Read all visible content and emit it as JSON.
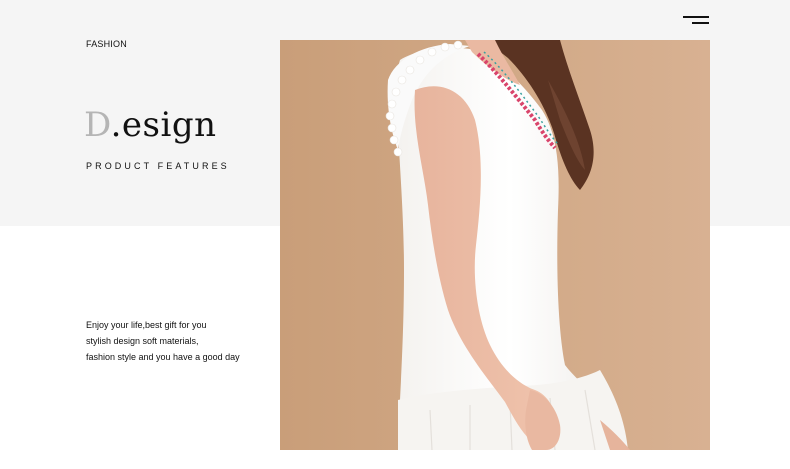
{
  "header": {
    "section_label": "FASHION",
    "menu_icon": "hamburger-menu-icon"
  },
  "hero": {
    "title_initial": "D",
    "title_rest": ".esign",
    "subtitle": "PRODUCT FEATURES"
  },
  "description": {
    "lines": [
      "Enjoy your life,best gift for you",
      "stylish design soft materials,",
      "fashion style and you have a good day"
    ]
  },
  "photo": {
    "subject": "model-in-white-sleeveless-dress",
    "background_color": "#d1a987",
    "dress_color": "#ffffff"
  },
  "colors": {
    "top_band": "#f5f5f5",
    "text": "#111111",
    "title_initial": "#b5b5b5",
    "embroidery": "#d9446b"
  }
}
